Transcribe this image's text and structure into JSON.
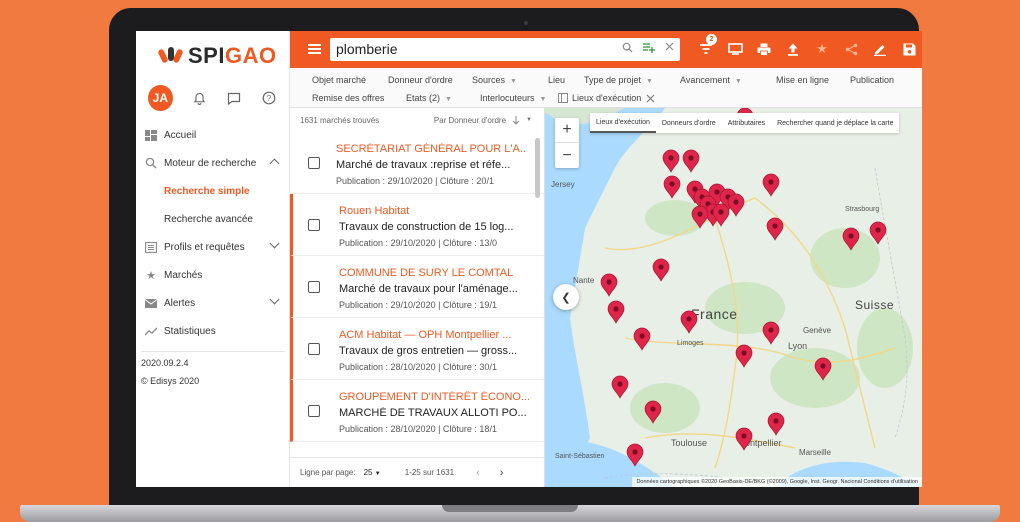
{
  "sidebar": {
    "logo_left": "SPI",
    "logo_right": "GAO",
    "user_initials": "JA",
    "items": [
      {
        "label": "Accueil",
        "icon": "dashboard-icon"
      },
      {
        "label": "Moteur de recherche",
        "icon": "search-icon"
      },
      {
        "label": "Recherche simple"
      },
      {
        "label": "Recherche avancée"
      },
      {
        "label": "Profils et requêtes",
        "icon": "list-icon"
      },
      {
        "label": "Marchés",
        "icon": "star-icon"
      },
      {
        "label": "Alertes",
        "icon": "mail-icon"
      },
      {
        "label": "Statistiques",
        "icon": "trend-icon"
      }
    ],
    "version": "2020.09.2.4",
    "copyright": "© Edisys 2020"
  },
  "topbar": {
    "search_value": "plomberie",
    "filter_badge": "2",
    "accent": "#f05a22"
  },
  "filters": {
    "row1": [
      "Objet marché",
      "Donneur d'ordre",
      "Sources",
      "Lieu",
      "Type de projet",
      "Avancement",
      "Mise en ligne",
      "Publication"
    ],
    "row2": [
      "Remise des offres",
      "Etats (2)",
      "Interlocuteurs",
      "Lieux d'exécution"
    ]
  },
  "results": {
    "count_label": "1631 marchés trouvés",
    "sort_label": "Par Donneur d'ordre",
    "items": [
      {
        "title": "SECRÉTARIAT GÉNÉRAL POUR L'A...",
        "desc": "Marché de travaux :reprise et réfe...",
        "pub": "Publication : 29/10/2020 | Clôture : 20/1"
      },
      {
        "title": "Rouen Habitat",
        "desc": "Travaux de construction de 15 log...",
        "pub": "Publication : 29/10/2020 | Clôture : 13/0"
      },
      {
        "title": "COMMUNE DE SURY LE COMTAL",
        "desc": "Marché de travaux pour l'aménage...",
        "pub": "Publication : 29/10/2020 | Clôture : 19/1"
      },
      {
        "title": "ACM Habitat — OPH Montpellier ...",
        "desc": "Travaux de gros entretien — gross...",
        "pub": "Publication : 28/10/2020 | Clôture : 30/1"
      },
      {
        "title": "GROUPEMENT D'INTÉRÊT ÉCONO...",
        "desc": "MARCHÉ DE TRAVAUX ALLOTI PO...",
        "pub": "Publication : 28/10/2020 | Clôture : 18/1"
      }
    ],
    "pager_label": "Ligne par page:",
    "pager_value": "25",
    "pager_range": "1-25 sur 1631"
  },
  "map": {
    "tabs": [
      "Lieux d'exécution",
      "Donneurs d'ordre",
      "Attributaires",
      "Rechercher quand je déplace la carte"
    ],
    "labels": [
      "Jersey",
      "Nante",
      "France",
      "Limoges",
      "Genève",
      "Lyon",
      "Suisse",
      "Toulouse",
      "ontpellier",
      "Saint-Sébastien",
      "Marseille",
      "Strasbourg"
    ],
    "attribution": "Données cartographiques ©2020 GeoBasis-DE/BKG (©2009), Google, Inst. Geogr. Nacional   Conditions d'utilisation",
    "pin_color": "#e0254a"
  }
}
